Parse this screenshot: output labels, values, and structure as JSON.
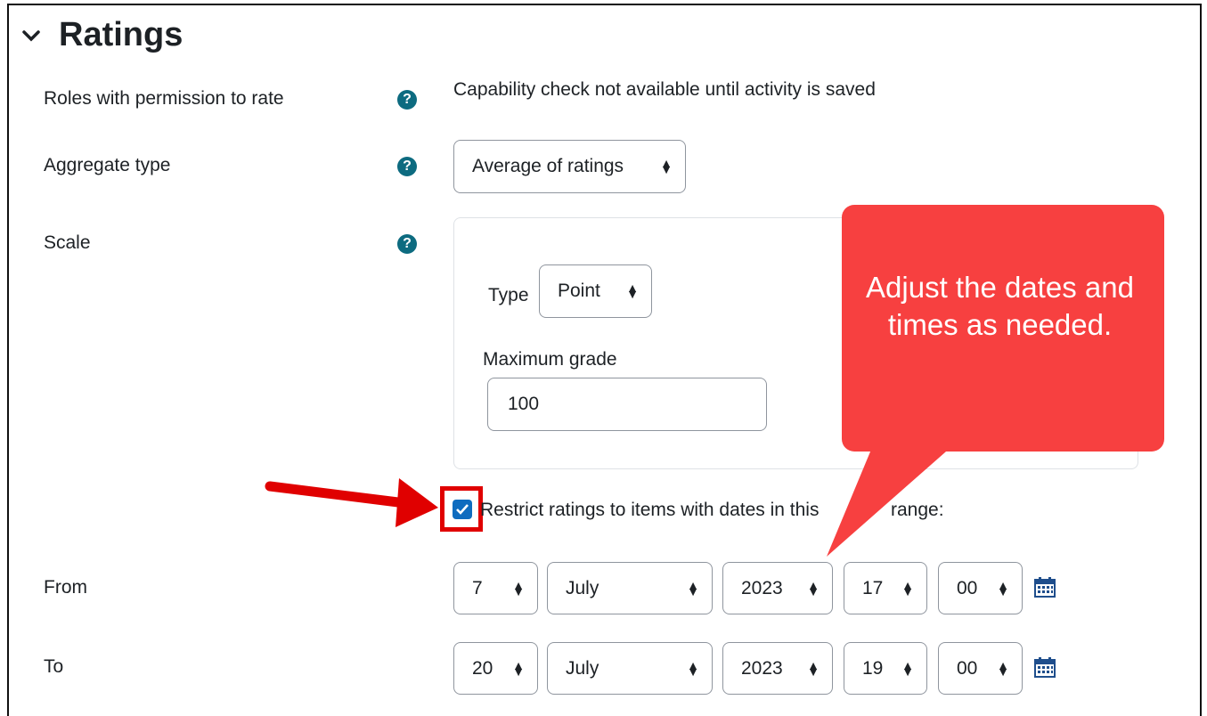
{
  "section": {
    "title": "Ratings"
  },
  "fields": {
    "roles": {
      "label": "Roles with permission to rate",
      "value": "Capability check not available until activity is saved"
    },
    "aggregate": {
      "label": "Aggregate type",
      "value": "Average of ratings"
    },
    "scale": {
      "label": "Scale",
      "type_label": "Type",
      "type_value": "Point",
      "max_grade_label": "Maximum grade",
      "max_grade_value": "100"
    },
    "restrict": {
      "label": "Restrict ratings to items with dates in this range:",
      "checked": true
    },
    "from": {
      "label": "From",
      "day": "7",
      "month": "July",
      "year": "2023",
      "hour": "17",
      "minute": "00"
    },
    "to": {
      "label": "To",
      "day": "20",
      "month": "July",
      "year": "2023",
      "hour": "19",
      "minute": "00"
    }
  },
  "help_icon_glyph": "?",
  "callout": {
    "text": "Adjust the dates and times as needed."
  },
  "colors": {
    "callout": "#f74040",
    "arrow": "#e00000",
    "help": "#0d6b80",
    "checkbox": "#0f6cbf"
  }
}
